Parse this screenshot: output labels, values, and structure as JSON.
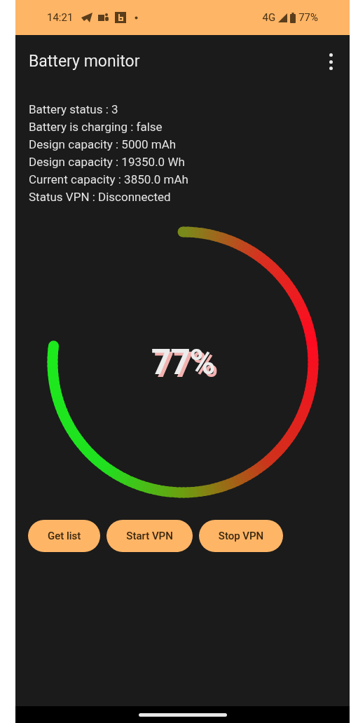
{
  "status_bar": {
    "time": "14:21",
    "network": "4G",
    "battery": "77%"
  },
  "app_bar": {
    "title": "Battery monitor"
  },
  "info_lines": [
    "Battery status : 3",
    "Battery is charging : false",
    "Design capacity : 5000 mAh",
    "Design capacity : 19350.0 Wh",
    "Current capacity : 3850.0 mAh",
    "Status VPN : Disconnected"
  ],
  "gauge": {
    "label": "77%"
  },
  "buttons": [
    "Get list",
    "Start VPN",
    "Stop VPN"
  ]
}
